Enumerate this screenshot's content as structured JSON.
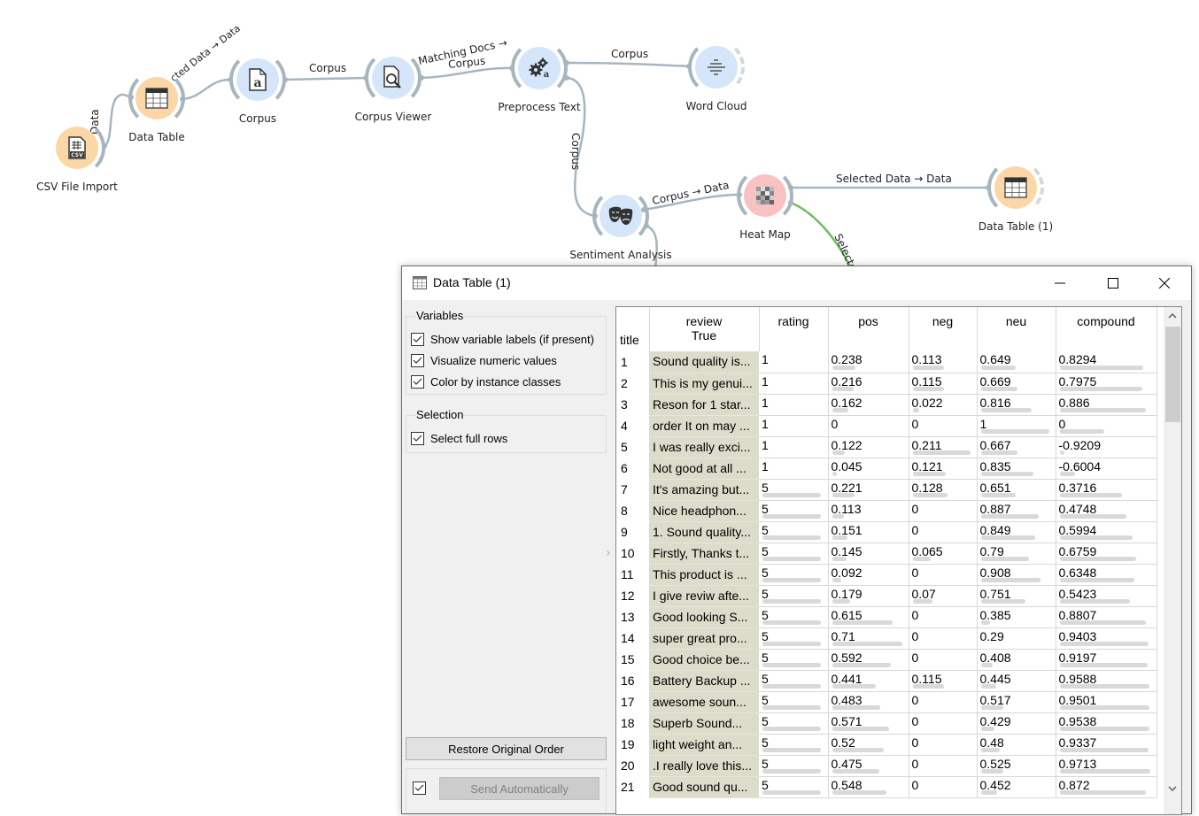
{
  "canvas": {
    "nodes": [
      {
        "id": "csv",
        "label": "CSV File Import",
        "icon": "csv-file-icon",
        "color": "orange"
      },
      {
        "id": "datatable",
        "label": "Data Table",
        "icon": "table-icon",
        "color": "orange"
      },
      {
        "id": "corpus",
        "label": "Corpus",
        "icon": "corpus-document-icon",
        "color": "blue"
      },
      {
        "id": "corpusviewer",
        "label": "Corpus Viewer",
        "icon": "document-search-icon",
        "color": "blue"
      },
      {
        "id": "preprocess",
        "label": "Preprocess Text",
        "icon": "gears-icon",
        "color": "blue"
      },
      {
        "id": "wordcloud",
        "label": "Word Cloud",
        "icon": "word-cloud-icon",
        "color": "blue"
      },
      {
        "id": "sentiment",
        "label": "Sentiment Analysis",
        "icon": "theater-masks-icon",
        "color": "blue"
      },
      {
        "id": "heatmap",
        "label": "Heat Map",
        "icon": "heatmap-icon",
        "color": "red"
      },
      {
        "id": "datatable1",
        "label": "Data Table (1)",
        "icon": "table-icon",
        "color": "orange"
      }
    ],
    "links": [
      {
        "label": "Data"
      },
      {
        "label": "Selected Data → Data",
        "visible_text": "cted Data → Data"
      },
      {
        "label": "Corpus"
      },
      {
        "label": "Matching Docs → Corpus",
        "line1": "Matching Docs →",
        "line2": "Corpus"
      },
      {
        "label": "Corpus"
      },
      {
        "label": "Corpus"
      },
      {
        "label": "Corpus → Data"
      },
      {
        "label": "Selected Data → Data"
      },
      {
        "label": "Selected",
        "visible_text": "Selecte"
      }
    ]
  },
  "window": {
    "title": "Data Table (1)",
    "variables_group": {
      "title": "Variables",
      "options": [
        {
          "label": "Show variable labels (if present)",
          "checked": true
        },
        {
          "label": "Visualize numeric values",
          "checked": true
        },
        {
          "label": "Color by instance classes",
          "checked": true
        }
      ]
    },
    "selection_group": {
      "title": "Selection",
      "options": [
        {
          "label": "Select full rows",
          "checked": true
        }
      ]
    },
    "restore_button": "Restore Original Order",
    "send_button": "Send Automatically",
    "send_auto_checked": true,
    "table": {
      "corner_label": "title",
      "columns": [
        {
          "name": "review",
          "sub": "True"
        },
        {
          "name": "rating",
          "sub": ""
        },
        {
          "name": "pos",
          "sub": ""
        },
        {
          "name": "neg",
          "sub": ""
        },
        {
          "name": "neu",
          "sub": ""
        },
        {
          "name": "compound",
          "sub": ""
        }
      ],
      "rows": [
        {
          "n": "1",
          "review": "Sound quality is...",
          "rating": "1",
          "pos": "0.238",
          "neg": "0.113",
          "neu": "0.649",
          "compound": "0.8294"
        },
        {
          "n": "2",
          "review": "This is my genui...",
          "rating": "1",
          "pos": "0.216",
          "neg": "0.115",
          "neu": "0.669",
          "compound": "0.7975"
        },
        {
          "n": "3",
          "review": "Reson for 1 star...",
          "rating": "1",
          "pos": "0.162",
          "neg": "0.022",
          "neu": "0.816",
          "compound": "0.886"
        },
        {
          "n": "4",
          "review": "order It on may ...",
          "rating": "1",
          "pos": "0",
          "neg": "0",
          "neu": "1",
          "compound": "0"
        },
        {
          "n": "5",
          "review": "I was really exci...",
          "rating": "1",
          "pos": "0.122",
          "neg": "0.211",
          "neu": "0.667",
          "compound": "-0.9209"
        },
        {
          "n": "6",
          "review": "Not good at all ...",
          "rating": "1",
          "pos": "0.045",
          "neg": "0.121",
          "neu": "0.835",
          "compound": "-0.6004"
        },
        {
          "n": "7",
          "review": "It's amazing but...",
          "rating": "5",
          "pos": "0.221",
          "neg": "0.128",
          "neu": "0.651",
          "compound": "0.3716"
        },
        {
          "n": "8",
          "review": "Nice headphon...",
          "rating": "5",
          "pos": "0.113",
          "neg": "0",
          "neu": "0.887",
          "compound": "0.4748"
        },
        {
          "n": "9",
          "review": "1. Sound quality...",
          "rating": "5",
          "pos": "0.151",
          "neg": "0",
          "neu": "0.849",
          "compound": "0.5994"
        },
        {
          "n": "10",
          "review": "Firstly, Thanks t...",
          "rating": "5",
          "pos": "0.145",
          "neg": "0.065",
          "neu": "0.79",
          "compound": "0.6759"
        },
        {
          "n": "11",
          "review": "This product is ...",
          "rating": "5",
          "pos": "0.092",
          "neg": "0",
          "neu": "0.908",
          "compound": "0.6348"
        },
        {
          "n": "12",
          "review": "I give reviw afte...",
          "rating": "5",
          "pos": "0.179",
          "neg": "0.07",
          "neu": "0.751",
          "compound": "0.5423"
        },
        {
          "n": "13",
          "review": "Good looking S...",
          "rating": "5",
          "pos": "0.615",
          "neg": "0",
          "neu": "0.385",
          "compound": "0.8807"
        },
        {
          "n": "14",
          "review": "super great pro...",
          "rating": "5",
          "pos": "0.71",
          "neg": "0",
          "neu": "0.29",
          "compound": "0.9403"
        },
        {
          "n": "15",
          "review": "Good choice be...",
          "rating": "5",
          "pos": "0.592",
          "neg": "0",
          "neu": "0.408",
          "compound": "0.9197"
        },
        {
          "n": "16",
          "review": "Battery Backup ...",
          "rating": "5",
          "pos": "0.441",
          "neg": "0.115",
          "neu": "0.445",
          "compound": "0.9588"
        },
        {
          "n": "17",
          "review": "awesome soun...",
          "rating": "5",
          "pos": "0.483",
          "neg": "0",
          "neu": "0.517",
          "compound": "0.9501"
        },
        {
          "n": "18",
          "review": "Superb Sound...",
          "rating": "5",
          "pos": "0.571",
          "neg": "0",
          "neu": "0.429",
          "compound": "0.9538"
        },
        {
          "n": "19",
          "review": "light weight an...",
          "rating": "5",
          "pos": "0.52",
          "neg": "0",
          "neu": "0.48",
          "compound": "0.9337"
        },
        {
          "n": "20",
          "review": ".I really love this...",
          "rating": "5",
          "pos": "0.475",
          "neg": "0",
          "neu": "0.525",
          "compound": "0.9713"
        },
        {
          "n": "21",
          "review": "Good sound qu...",
          "rating": "5",
          "pos": "0.548",
          "neg": "0",
          "neu": "0.452",
          "compound": "0.872"
        }
      ],
      "bar_ranges": {
        "rating": [
          1,
          5
        ],
        "pos": [
          0,
          0.71
        ],
        "neg": [
          0,
          0.211
        ],
        "neu": [
          0.29,
          1
        ],
        "compound": [
          -0.9209,
          0.9713
        ]
      },
      "scroll_position": 0
    }
  }
}
